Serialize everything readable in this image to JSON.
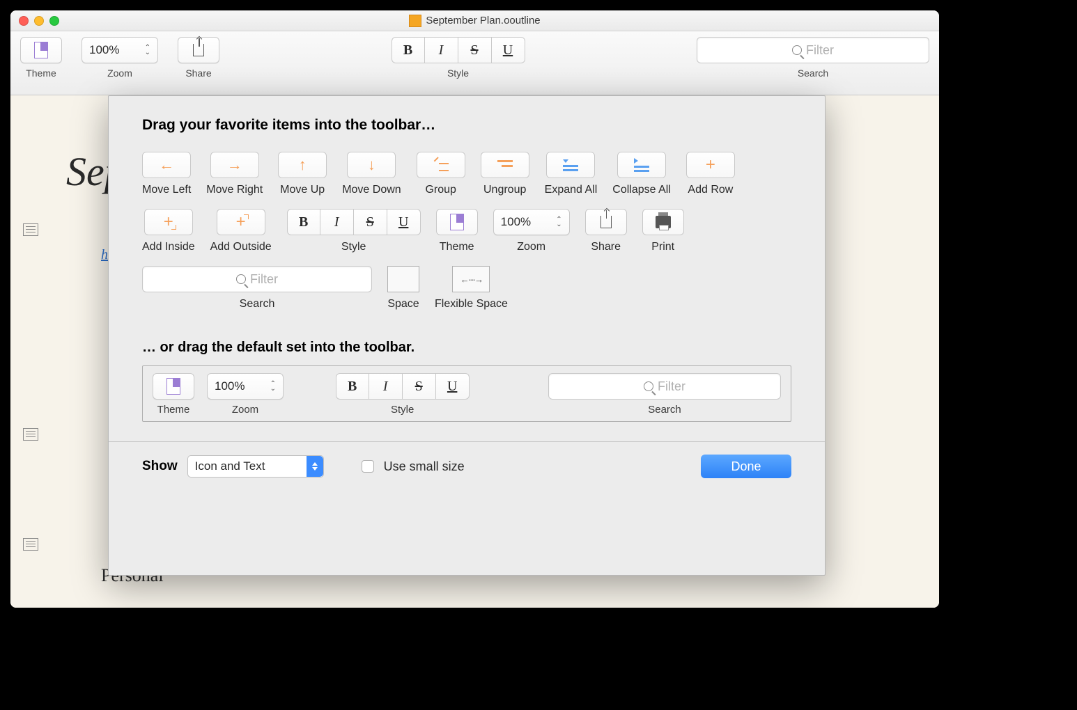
{
  "titlebar": {
    "title": "September Plan.ooutline"
  },
  "toolbar": {
    "theme_label": "Theme",
    "zoom_label": "Zoom",
    "zoom_value": "100%",
    "share_label": "Share",
    "style_label": "Style",
    "search_label": "Search",
    "filter_placeholder": "Filter"
  },
  "background": {
    "september_fragment": "Sep",
    "link_fragment": "h",
    "personal": "Personal"
  },
  "sheet": {
    "heading": "Drag your favorite items into the toolbar…",
    "items": {
      "move_left": "Move Left",
      "move_right": "Move Right",
      "move_up": "Move Up",
      "move_down": "Move Down",
      "group": "Group",
      "ungroup": "Ungroup",
      "expand_all": "Expand All",
      "collapse_all": "Collapse All",
      "add_row": "Add Row",
      "add_inside": "Add Inside",
      "add_outside": "Add Outside",
      "style": "Style",
      "theme": "Theme",
      "zoom": "Zoom",
      "zoom_value": "100%",
      "share": "Share",
      "print": "Print",
      "search": "Search",
      "space": "Space",
      "flexible_space": "Flexible Space"
    },
    "subheading": "… or drag the default set into the toolbar.",
    "default_set": {
      "theme": "Theme",
      "zoom": "Zoom",
      "zoom_value": "100%",
      "style": "Style",
      "search": "Search",
      "filter_placeholder": "Filter"
    },
    "footer": {
      "show_label": "Show",
      "show_value": "Icon and Text",
      "small_size": "Use small size",
      "done": "Done"
    }
  }
}
